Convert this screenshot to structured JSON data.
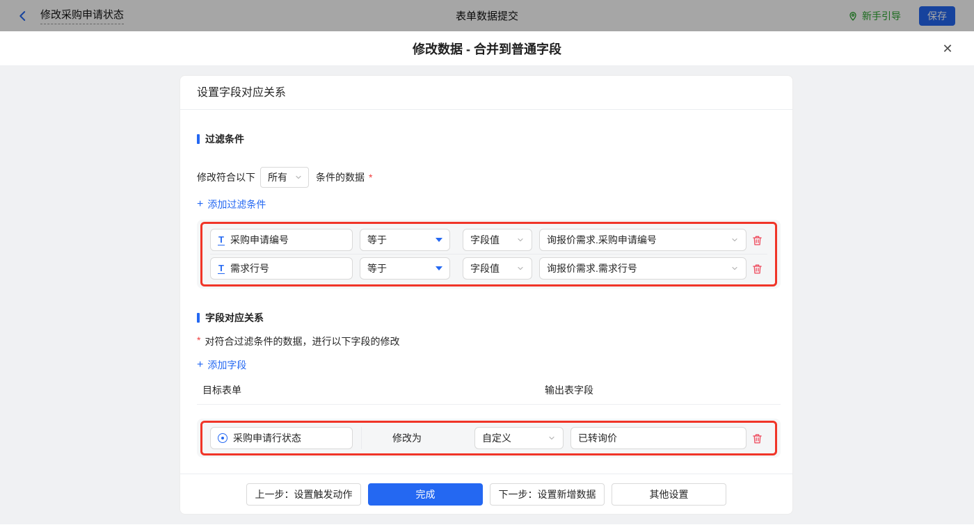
{
  "topbar": {
    "back_title": "修改采购申请状态",
    "center_title": "表单数据提交",
    "guide_label": "新手引导",
    "save_label": "保存"
  },
  "dialog": {
    "title": "修改数据 - 合并到普通字段",
    "close_glyph": "✕"
  },
  "panel": {
    "header": "设置字段对应关系",
    "filter": {
      "section_title": "过滤条件",
      "match_prefix": "修改符合以下",
      "match_mode": "所有",
      "match_suffix": "条件的数据",
      "required_mark": "*",
      "add_label": "添加过滤条件",
      "rows": [
        {
          "field": "采购申请编号",
          "operator": "等于",
          "value_type": "字段值",
          "value": "询报价需求.采购申请编号"
        },
        {
          "field": "需求行号",
          "operator": "等于",
          "value_type": "字段值",
          "value": "询报价需求.需求行号"
        }
      ]
    },
    "mapping": {
      "section_title": "字段对应关系",
      "required_mark": "*",
      "description": "对符合过滤条件的数据，进行以下字段的修改",
      "add_label": "添加字段",
      "col_target": "目标表单",
      "col_output": "输出表字段",
      "rows": [
        {
          "field": "采购申请行状态",
          "action": "修改为",
          "mode": "自定义",
          "value": "已转询价"
        }
      ]
    }
  },
  "footer": {
    "prev_label": "上一步：设置触发动作",
    "done_label": "完成",
    "next_label": "下一步：设置新增数据",
    "other_label": "其他设置"
  },
  "icons": {
    "plus": "+",
    "field_type_glyph": "T"
  },
  "colors": {
    "accent": "#2468f2",
    "highlight_red": "#f03528",
    "danger_red": "#ee4558",
    "guide_green": "#2aa52e"
  }
}
